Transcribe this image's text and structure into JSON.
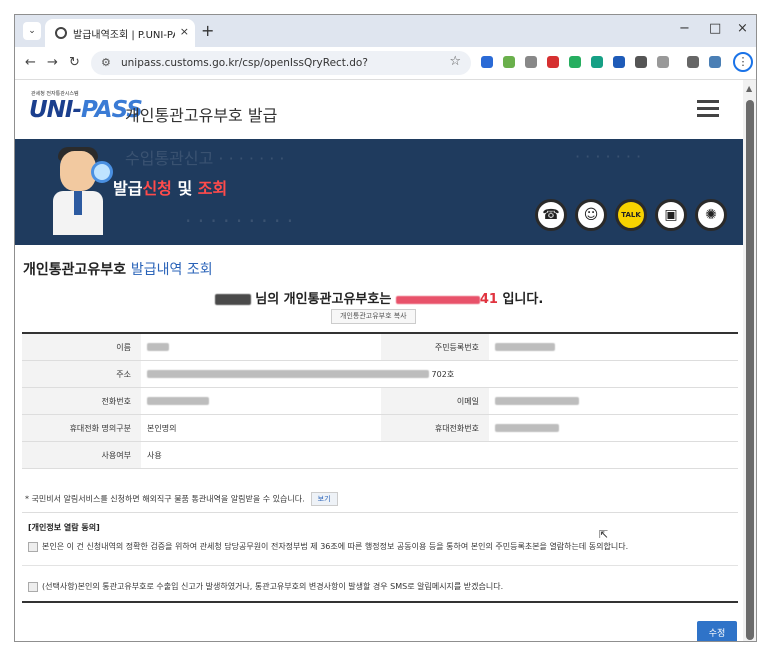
{
  "browser": {
    "tab_title": "발급내역조회 | P.UNI-PASS 개(",
    "url": "unipass.customs.go.kr/csp/openIssQryRect.do?",
    "tab_close": "×",
    "new_tab": "+",
    "minimize": "−",
    "maximize": "□",
    "close": "×"
  },
  "header": {
    "logo_small": "관세청 전자통관시스템",
    "logo_uni": "UNI-",
    "logo_pass": "PASS",
    "site_title": "개인통관고유부호 발급"
  },
  "banner": {
    "title_a": "발급",
    "title_b": "신청",
    "title_c": " 및 ",
    "title_d": "조회",
    "icons": [
      "phone-icon",
      "chatbot-icon",
      "talk-icon",
      "screen-icon",
      "customs-emblem-icon"
    ]
  },
  "main": {
    "heading_black": "개인통관고유부호 ",
    "heading_blue": "발급내역 조회",
    "notice_mid": " 님의 개인통관고유부호는 ",
    "notice_digits": "41",
    "notice_end": " 입니다.",
    "copy_button": "개인통관고유부호 복사"
  },
  "table": {
    "name_label": "이름",
    "rrn_label": "주민등록번호",
    "address_label": "주소",
    "address_suffix": "702호",
    "phone_label": "전화번호",
    "email_label": "이메일",
    "mobile_type_label": "휴대전화 명의구분",
    "mobile_type_value": "본인명의",
    "mobile_label": "휴대전화번호",
    "usage_label": "사용여부",
    "usage_value": "사용"
  },
  "footnote": {
    "text": "* 국민비서 알림서비스를 신청하면 해외직구 물품 통관내역을 알림받을 수 있습니다.",
    "button": "보기"
  },
  "agreement": {
    "title": "[개인정보 열람 동의]",
    "item1": "본인은 이 건 신청내역의 정확한 검증을 위하여 관세청 담당공무원이 전자정부법 제 36조에 따른 행정정보 공동이용 등을 통하여 본인의 주민등록초본을 열람하는데 동의합니다.",
    "item2": "(선택사항)본인의 통관고유부호로 수출입 신고가 발생하였거나, 통관고유부호의 변경사항이 발생할 경우 SMS로 알림메시지를 받겠습니다."
  },
  "edit_button": "수정"
}
